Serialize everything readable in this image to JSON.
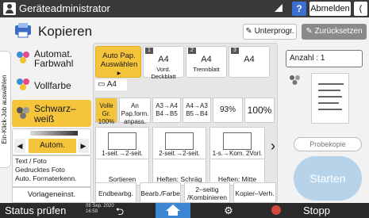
{
  "topbar": {
    "title": "Geräteadministrator",
    "help": "?",
    "logout": "Abmelden",
    "power": "("
  },
  "app": {
    "title": "Kopieren",
    "unterprog": "Unterprogr.",
    "zurueck": "Zurücksetzen"
  },
  "left_tab": "Ein-Klick-Job auswählen",
  "color_options": [
    {
      "label_line1": "Automat.",
      "label_line2": "Farbwahl"
    },
    {
      "label_line1": "Vollfarbe",
      "label_line2": ""
    },
    {
      "label_line1": "Schwarz–",
      "label_line2": "weiß"
    }
  ],
  "density": {
    "mode": "Autom.",
    "left": "◀",
    "right": "▶"
  },
  "text_foto": {
    "line1": "Text / Foto",
    "line2": "Gedrucktes Foto",
    "line3": "Auto. Formaterkenn."
  },
  "vorlage": "Vorlageneinst.",
  "paper": {
    "auto": "Auto Pap. Auswählen ▸",
    "trays": [
      {
        "num": "1",
        "size": "A4",
        "sub": "Vord. Deckblatt"
      },
      {
        "num": "2",
        "size": "A4",
        "sub": "Trennblatt"
      },
      {
        "num": "3",
        "size": "A4",
        "sub": ""
      }
    ],
    "bypass": "A4"
  },
  "scale": [
    {
      "l1": "Volle Gr.",
      "l2": "100%"
    },
    {
      "l1": "An Pap.form.",
      "l2": "anpass."
    },
    {
      "l1": "A3→A4",
      "l2": "B4→B5"
    },
    {
      "l1": "A4→A3",
      "l2": "B5→B4"
    },
    {
      "l1": "93%",
      "l2": ""
    },
    {
      "l1": "100%",
      "l2": ""
    }
  ],
  "duplex": [
    {
      "label": "1-seit.→2-seit."
    },
    {
      "label": "2-seit.→2-seit."
    },
    {
      "label": "1-s.→Kom. 2Vorl."
    }
  ],
  "finish": [
    {
      "label": "Sortieren"
    },
    {
      "label": "Heften: Schräg"
    },
    {
      "label": "Heften: Mitte"
    }
  ],
  "bottom": [
    {
      "l1": "Endbearbg.",
      "l2": ""
    },
    {
      "l1": "Bearb./Farbe",
      "l2": ""
    },
    {
      "l1": "2–seitig",
      "l2": "/Kombinieren"
    },
    {
      "l1": "Kopier–Verh.",
      "l2": ""
    }
  ],
  "right": {
    "anzahl": "Anzahl : 1",
    "probekopie": "Probekopie",
    "starten": "Starten"
  },
  "status": {
    "label": "Status prüfen",
    "date": "08 Sep. 2020",
    "time": "16:59",
    "stop": "Stopp"
  },
  "colors": {
    "accent": "#f4c43a",
    "topbar": "#3a3a3a",
    "start": "#b7d3ea",
    "home": "#3d86d3"
  }
}
